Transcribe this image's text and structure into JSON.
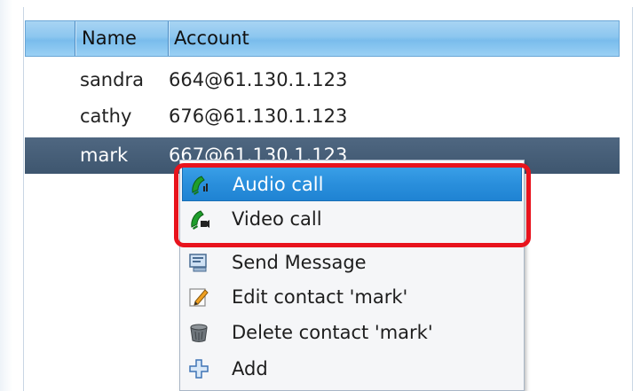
{
  "table": {
    "columns": [
      "Name",
      "Account"
    ],
    "rows": [
      {
        "name": "sandra",
        "account": "664@61.130.1.123"
      },
      {
        "name": "cathy",
        "account": "676@61.130.1.123"
      },
      {
        "name": "mark",
        "account": "667@61.130.1.123"
      }
    ],
    "selected_row": "mark"
  },
  "context_menu": {
    "items": [
      {
        "label": "Audio call",
        "icon": "audio-call-icon",
        "highlighted": true
      },
      {
        "label": "Video call",
        "icon": "video-call-icon"
      },
      {
        "label": "Send Message",
        "icon": "message-icon"
      },
      {
        "label": "Edit contact 'mark'",
        "icon": "edit-icon"
      },
      {
        "label": "Delete contact 'mark'",
        "icon": "trash-icon"
      },
      {
        "label": "Add",
        "icon": "add-icon"
      }
    ]
  },
  "colors": {
    "header": "#8cc6ef",
    "selected_row": "#465e78",
    "menu_highlight": "#2a8fdc",
    "annotation": "#e8131d"
  }
}
